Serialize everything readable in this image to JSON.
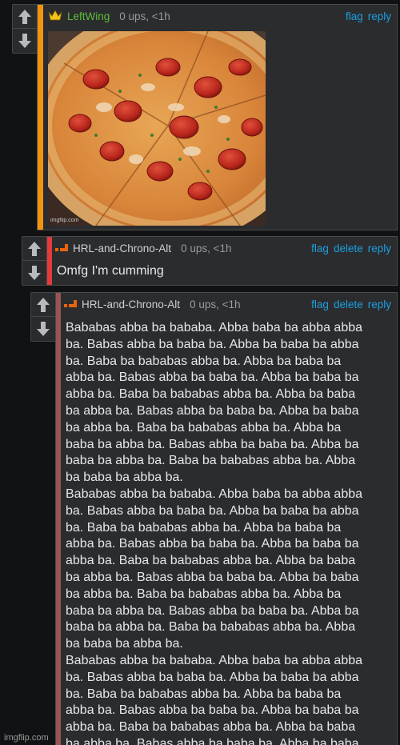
{
  "comments": [
    {
      "username": "LeftWing",
      "meta": "0 ups, <1h",
      "actions": [
        "flag",
        "reply"
      ],
      "accent_color": "#f4930f",
      "username_color": "#5cbe3c",
      "badge_icon": "crown-icon",
      "image_watermark": "imgflip.com"
    },
    {
      "username": "HRL-and-Chrono-Alt",
      "meta": "0 ups, <1h",
      "actions": [
        "flag",
        "delete",
        "reply"
      ],
      "accent_color": "#e33b3b",
      "username_color": "#cfcfcf",
      "badge_icon": "ribbon-icon",
      "text": "Omfg I'm cumming"
    },
    {
      "username": "HRL-and-Chrono-Alt",
      "meta": "0 ups, <1h",
      "actions": [
        "flag",
        "delete",
        "reply"
      ],
      "accent_color": "#9b5454",
      "username_color": "#cfcfcf",
      "badge_icon": "ribbon-icon",
      "lines": [
        "Bababas abba ba bababa. Abba baba ba abba abba",
        "ba. Babas abba ba baba ba. Abba ba baba ba abba",
        "ba. Baba ba bababas abba ba. Abba ba baba ba",
        "abba ba. Babas abba ba baba ba. Abba ba baba ba",
        "abba ba. Baba ba bababas abba ba. Abba ba baba",
        "ba abba ba. Babas abba ba baba ba. Abba ba baba",
        "ba abba ba. Baba ba bababas abba ba. Abba ba",
        "baba ba abba ba. Babas abba ba baba ba. Abba ba",
        "baba ba abba ba. Baba ba bababas abba ba. Abba",
        "ba baba ba abba ba.",
        "Bababas abba ba bababa. Abba baba ba abba abba",
        "ba. Babas abba ba baba ba. Abba ba baba ba abba",
        "ba. Baba ba bababas abba ba. Abba ba baba ba",
        "abba ba. Babas abba ba baba ba. Abba ba baba ba",
        "abba ba. Baba ba bababas abba ba. Abba ba baba",
        "ba abba ba. Babas abba ba baba ba. Abba ba baba",
        "ba abba ba. Baba ba bababas abba ba. Abba ba",
        "baba ba abba ba. Babas abba ba baba ba. Abba ba",
        "baba ba abba ba. Baba ba bababas abba ba. Abba",
        "ba baba ba abba ba.",
        "Bababas abba ba bababa. Abba baba ba abba abba",
        "ba. Babas abba ba baba ba. Abba ba baba ba abba",
        "ba. Baba ba bababas abba ba. Abba ba baba ba",
        "abba ba. Babas abba ba baba ba. Abba ba baba ba",
        "abba ba. Baba ba bababas abba ba. Abba ba baba",
        "ba abba ba. Babas abba ba baba ba. Abba ba baba"
      ]
    }
  ],
  "footer_watermark": "imgflip.com",
  "icons": {
    "upvote": "up-arrow-icon",
    "downvote": "down-arrow-icon"
  }
}
